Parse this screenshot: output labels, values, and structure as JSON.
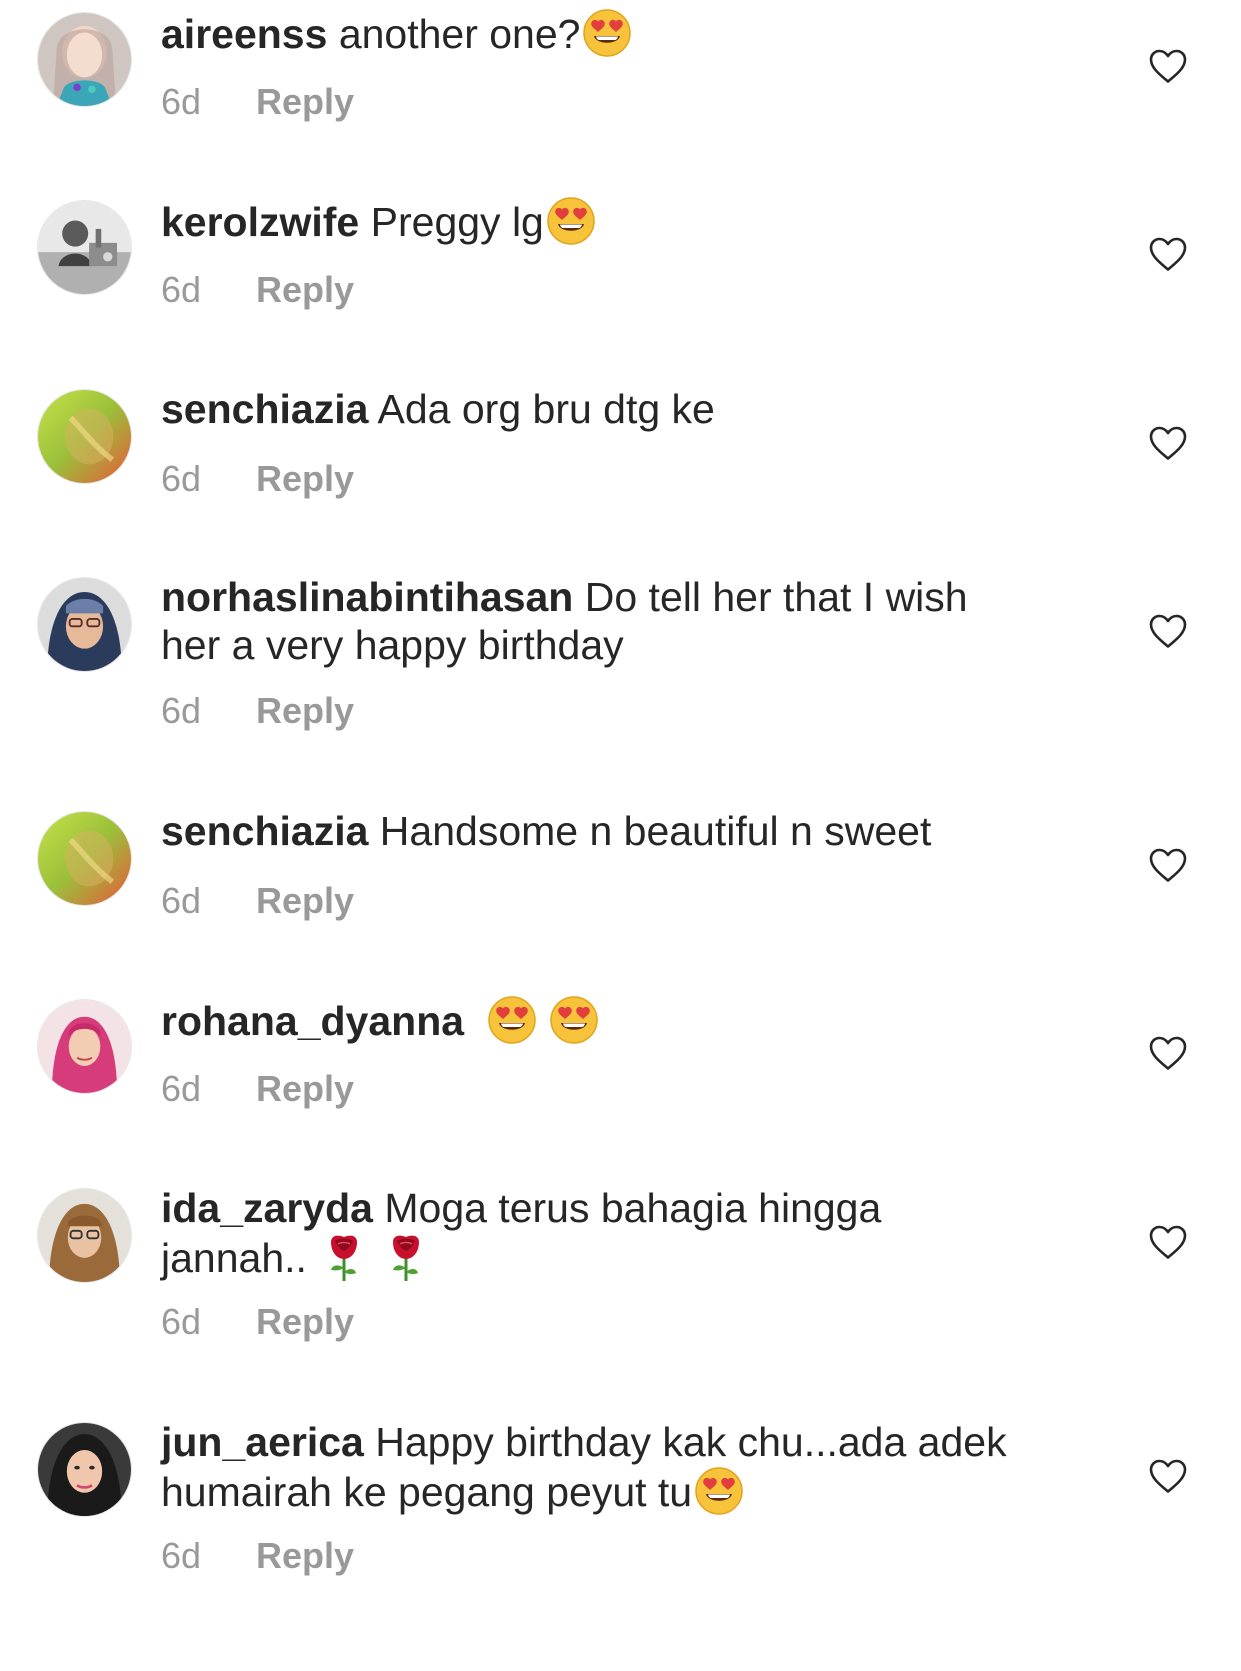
{
  "comments": [
    {
      "username": "aireenss",
      "text": "another one?",
      "emojis": [
        "heart-eyes"
      ],
      "time": "6d",
      "reply_label": "Reply"
    },
    {
      "username": "kerolzwife",
      "text": "Preggy lg",
      "emojis": [
        "heart-eyes"
      ],
      "time": "6d",
      "reply_label": "Reply"
    },
    {
      "username": "senchiazia",
      "text": "Ada org bru dtg ke",
      "emojis": [],
      "time": "6d",
      "reply_label": "Reply"
    },
    {
      "username": "norhaslinabintihasan",
      "text": "Do tell her that I wish her a very happy birthday",
      "emojis": [],
      "time": "6d",
      "reply_label": "Reply"
    },
    {
      "username": "senchiazia",
      "text": "Handsome n beautiful n sweet",
      "emojis": [],
      "time": "6d",
      "reply_label": "Reply"
    },
    {
      "username": "rohana_dyanna",
      "text": "",
      "emojis": [
        "heart-eyes",
        "heart-eyes"
      ],
      "time": "6d",
      "reply_label": "Reply"
    },
    {
      "username": "ida_zaryda",
      "text": "Moga terus bahagia hingga jannah..",
      "emojis": [
        "rose",
        "rose"
      ],
      "time": "6d",
      "reply_label": "Reply"
    },
    {
      "username": "jun_aerica",
      "text": "Happy birthday kak chu...ada adek humairah ke pegang peyut tu",
      "emojis": [
        "heart-eyes"
      ],
      "time": "6d",
      "reply_label": "Reply"
    }
  ],
  "icons": {
    "like": "heart-outline-icon",
    "heart_eyes": "smiling-face-with-heart-eyes-emoji",
    "rose": "rose-emoji"
  },
  "colors": {
    "text": "#262626",
    "meta": "#999999",
    "icon": "#262626",
    "background": "#ffffff"
  }
}
